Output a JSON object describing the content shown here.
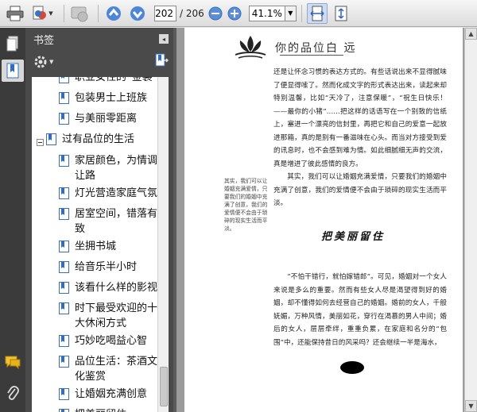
{
  "toolbar": {
    "current_page": "202",
    "total_pages": "/ 206",
    "zoom": "41.1%",
    "icons": [
      "print-icon",
      "share-icon",
      "collaborate-icon",
      "previous-page-icon",
      "next-page-icon",
      "zoom-out-icon",
      "zoom-in-icon",
      "fit-width-icon",
      "fit-page-icon"
    ]
  },
  "panel": {
    "title": "书签",
    "close_glyph": "◂"
  },
  "bookmarks": [
    {
      "level": 2,
      "label": "职业女性的“金装”"
    },
    {
      "level": 2,
      "label": "包装男士上班族"
    },
    {
      "level": 2,
      "label": "与美丽零距离"
    },
    {
      "level": 1,
      "label": "过有品位的生活",
      "expanded": true
    },
    {
      "level": 2,
      "label": "家居颜色，为情调让路"
    },
    {
      "level": 2,
      "label": "灯光营造家庭气氛"
    },
    {
      "level": 2,
      "label": "居室空间，错落有致"
    },
    {
      "level": 2,
      "label": "坐拥书城"
    },
    {
      "level": 2,
      "label": "给音乐半小时"
    },
    {
      "level": 2,
      "label": "该看什么样的影视"
    },
    {
      "level": 2,
      "label": "时下最受欢迎的十大休闲方式"
    },
    {
      "level": 2,
      "label": "巧妙吃喝益心智"
    },
    {
      "level": 2,
      "label": "品位生活：茶酒文化鉴赏"
    },
    {
      "level": 2,
      "label": "让婚姻充满创意"
    },
    {
      "level": 2,
      "label": "把美丽留住"
    }
  ],
  "document": {
    "header_title": "你的品位白 远",
    "paragraph_1": "还是让怀念习惯的表达方式的。有些话说出来不显得腻味了便显得嗦了。然而化成文字的形式表达出来，读起来却特别温馨，比如“天冷了，注意保暖”，“祝生日快乐！——最你的小猪”……把这样的话语写在一个别致的信纸上，塞进一个漂亮的信封里，再把它和自己的爱意一起放进那箱，真的是别有一番滋味在心头。而当对方接受到爱的讯息时，也不会感到难为情。如此细腻细无声的交流，真是增进了彼此感情的良方。",
    "paragraph_2": "其实，我们可以让婚姻充满爱情，只要我们的婚姻中充满了创意，我们的爱情便不会由于琐碎的现实生活而平淡。",
    "side_note": "其实，我们可以让婚姻充满爱情，只要我们的婚姻中充满了创意，我们的爱情便不会由于琐碎的现实生活而平淡。",
    "section_title": "把美丽留住",
    "paragraph_3": "“不怕干错行，就怕嫁错郎”。可见，婚姻对一个女人来说是多么的重要。然而有些女人尽是渴望得到好的婚姻，却不懂得如何去经营自己的婚姻。婚前的女人，千般妩媚，万种风情，美丽如花，穿行在渴慕的男人中间；婚后的女人，层层牵绊，重重负累，在家庭和名分的“包围”中，还能保持昔日的风采吗？还会继续一半是海水，"
  }
}
